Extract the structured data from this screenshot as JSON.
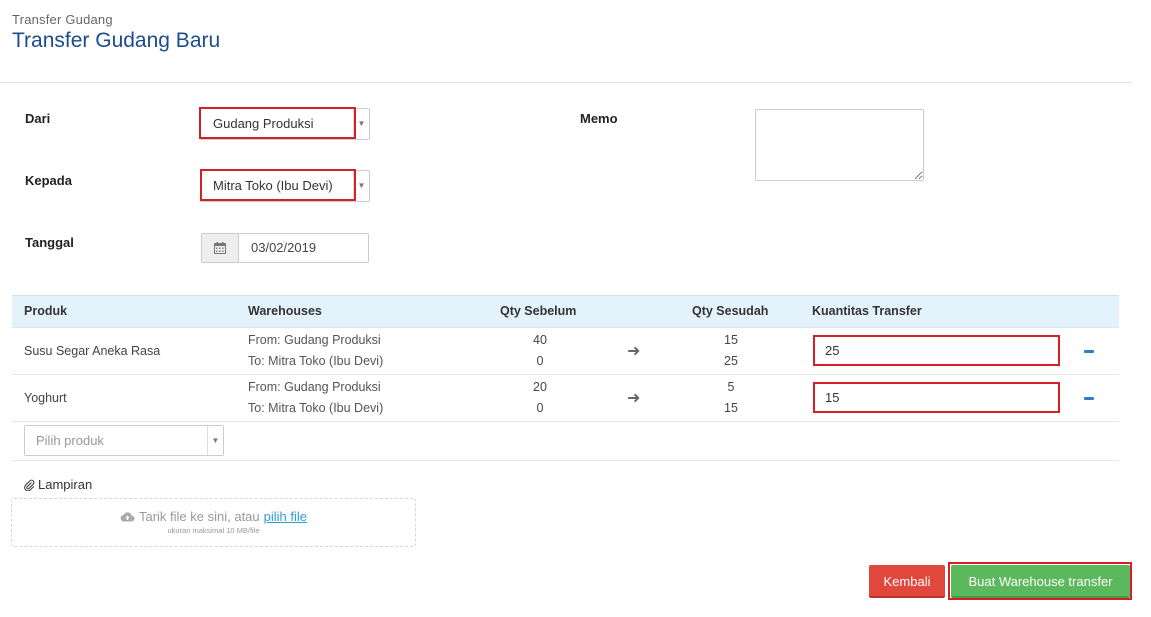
{
  "header": {
    "breadcrumb": "Transfer Gudang",
    "title": "Transfer Gudang Baru"
  },
  "form": {
    "dari_label": "Dari",
    "dari_value": "Gudang Produksi",
    "kepada_label": "Kepada",
    "kepada_value": "Mitra Toko (Ibu Devi)",
    "tanggal_label": "Tanggal",
    "tanggal_value": "03/02/2019",
    "memo_label": "Memo",
    "memo_value": ""
  },
  "table": {
    "headers": {
      "produk": "Produk",
      "warehouses": "Warehouses",
      "qty_sebelum": "Qty Sebelum",
      "qty_sesudah": "Qty Sesudah",
      "kuantitas": "Kuantitas Transfer"
    },
    "rows": [
      {
        "produk": "Susu Segar Aneka Rasa",
        "from": "From: Gudang Produksi",
        "to": "To: Mitra Toko (Ibu Devi)",
        "sebelum_from": "40",
        "sebelum_to": "0",
        "sesudah_from": "15",
        "sesudah_to": "25",
        "kuantitas": "25"
      },
      {
        "produk": "Yoghurt",
        "from": "From: Gudang Produksi",
        "to": "To: Mitra Toko (Ibu Devi)",
        "sebelum_from": "20",
        "sebelum_to": "0",
        "sesudah_from": "5",
        "sesudah_to": "15",
        "kuantitas": "15"
      }
    ],
    "pilih_placeholder": "Pilih produk"
  },
  "attachment": {
    "label": "Lampiran",
    "drop_text": "Tarik file ke sini, atau",
    "drop_link": "pilih file",
    "drop_sub": "ukuran maksimal 10 MB/file"
  },
  "actions": {
    "back_label": "Kembali",
    "create_label": "Buat Warehouse transfer"
  },
  "colors": {
    "title": "#1c4b8e",
    "highlight": "#d62029",
    "back_button": "#e2473b",
    "create_button": "#5cb85c",
    "table_header": "#e4f3fb",
    "minus_icon": "#2b7cc9"
  }
}
